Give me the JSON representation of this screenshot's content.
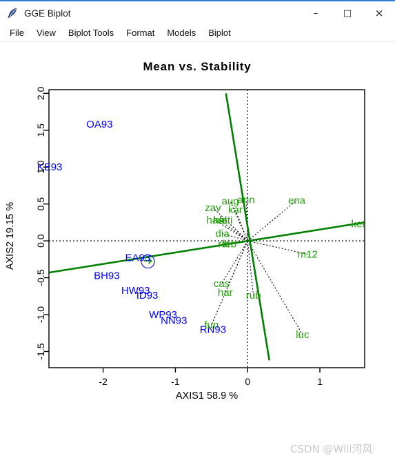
{
  "window": {
    "title": "GGE Biplot",
    "icon": "r-feather-icon",
    "buttons": {
      "minimize": "–",
      "maximize": "□",
      "close": "×"
    }
  },
  "menu": {
    "items": [
      {
        "label": "File",
        "name": "menu-file"
      },
      {
        "label": "View",
        "name": "menu-view"
      },
      {
        "label": "Biplot Tools",
        "name": "menu-biplot-tools"
      },
      {
        "label": "Format",
        "name": "menu-format"
      },
      {
        "label": "Models",
        "name": "menu-models"
      },
      {
        "label": "Biplot",
        "name": "menu-biplot"
      }
    ]
  },
  "watermark": "CSDN @Will河风",
  "colors": {
    "genotype": "#0000ff",
    "environment": "#22a00a",
    "axis_line": "#008000",
    "frame": "#000000",
    "dotted": "#000000",
    "watermark": "#c9c9c9",
    "titlebar_accent": "#2d7cd6"
  },
  "chart_data": {
    "type": "scatter",
    "title": "Mean vs. Stability",
    "xlabel": "AXIS1 58.9 %",
    "ylabel": "AXIS2 19.15 %",
    "xlim": [
      -2.75,
      1.62
    ],
    "ylim": [
      -1.72,
      2.05
    ],
    "xticks": [
      -2,
      -1,
      0,
      1
    ],
    "yticks": [
      -1.5,
      -1.0,
      -0.5,
      0.0,
      0.5,
      1.0,
      1.5,
      2.0
    ],
    "ytick_labels": [
      "-1.5",
      "-1.0",
      "-0.5",
      "0.0",
      "0.5",
      "1.0",
      "1.5",
      "2.0"
    ],
    "xtick_labels": [
      "-2",
      "-1",
      "0",
      "1"
    ],
    "grid": false,
    "legend": "none",
    "reference_lines": {
      "horizontal_dotted_y": 0.0,
      "vertical_dotted_x": 0.0,
      "aec_abscissa": {
        "x1": -2.75,
        "y1": -0.43,
        "x2": 1.62,
        "y2": 0.25
      },
      "aec_ordinate": {
        "x1": -0.3,
        "y1": 2.0,
        "x2": 0.3,
        "y2": -1.62
      }
    },
    "average_environment_marker": {
      "x": -1.38,
      "y": -0.28,
      "shape": "circle-with-arrow"
    },
    "genotypes": [
      {
        "label": "OA93",
        "x": -2.05,
        "y": 1.58
      },
      {
        "label": "KE93",
        "x": -2.74,
        "y": 1.0
      },
      {
        "label": "EA93",
        "x": -1.52,
        "y": -0.23
      },
      {
        "label": "BH93",
        "x": -1.95,
        "y": -0.47
      },
      {
        "label": "HW93",
        "x": -1.55,
        "y": -0.67
      },
      {
        "label": "ID93",
        "x": -1.39,
        "y": -0.74
      },
      {
        "label": "WP93",
        "x": -1.17,
        "y": -1.0
      },
      {
        "label": "NN93",
        "x": -1.02,
        "y": -1.08
      },
      {
        "label": "RN93",
        "x": -0.48,
        "y": -1.2
      }
    ],
    "environments": [
      {
        "label": "zav",
        "x": -0.48,
        "y": 0.45
      },
      {
        "label": "aug",
        "x": -0.24,
        "y": 0.54
      },
      {
        "label": "ann",
        "x": -0.02,
        "y": 0.56
      },
      {
        "label": "kar",
        "x": -0.17,
        "y": 0.42
      },
      {
        "label": "han",
        "x": -0.45,
        "y": 0.28
      },
      {
        "label": "hal",
        "x": -0.38,
        "y": 0.28
      },
      {
        "label": "lati",
        "x": -0.3,
        "y": 0.28
      },
      {
        "label": "dia",
        "x": -0.35,
        "y": 0.1
      },
      {
        "label": "rol",
        "x": -0.33,
        "y": -0.04
      },
      {
        "label": "leb",
        "x": -0.25,
        "y": -0.04
      },
      {
        "label": "cas",
        "x": -0.36,
        "y": -0.58
      },
      {
        "label": "har",
        "x": -0.31,
        "y": -0.7
      },
      {
        "label": "fun",
        "x": -0.5,
        "y": -1.14
      },
      {
        "label": "rub",
        "x": 0.08,
        "y": -0.74
      },
      {
        "label": "ena",
        "x": 0.68,
        "y": 0.55
      },
      {
        "label": "ket",
        "x": 1.53,
        "y": 0.23
      },
      {
        "label": "m12",
        "x": 0.83,
        "y": -0.18
      },
      {
        "label": "luc",
        "x": 0.76,
        "y": -1.27
      }
    ]
  }
}
